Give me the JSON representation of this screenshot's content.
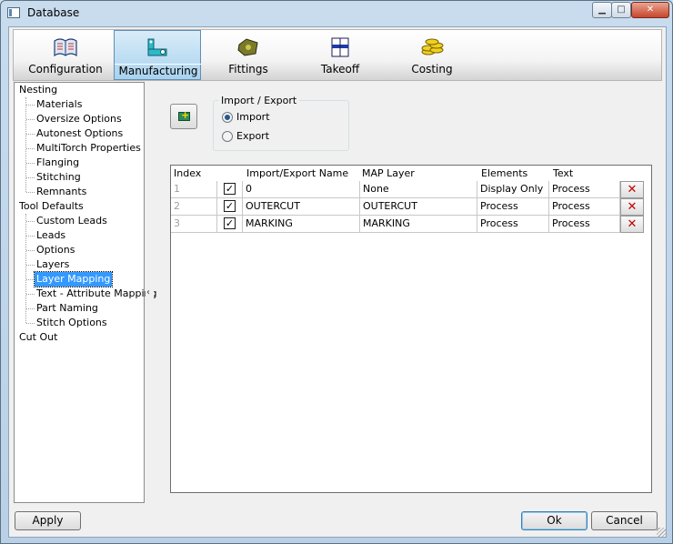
{
  "window": {
    "title": "Database"
  },
  "toolbar": {
    "items": [
      {
        "label": "Configuration",
        "icon": "book-icon",
        "active": false
      },
      {
        "label": "Manufacturing",
        "icon": "machine-icon",
        "active": true
      },
      {
        "label": "Fittings",
        "icon": "fitting-icon",
        "active": false
      },
      {
        "label": "Takeoff",
        "icon": "takeoff-icon",
        "active": false
      },
      {
        "label": "Costing",
        "icon": "coins-icon",
        "active": false
      }
    ]
  },
  "tree": {
    "items": [
      {
        "label": "Nesting",
        "level": 0
      },
      {
        "label": "Materials",
        "level": 1
      },
      {
        "label": "Oversize Options",
        "level": 1
      },
      {
        "label": "Autonest Options",
        "level": 1
      },
      {
        "label": "MultiTorch Properties",
        "level": 1
      },
      {
        "label": "Flanging",
        "level": 1
      },
      {
        "label": "Stitching",
        "level": 1
      },
      {
        "label": "Remnants",
        "level": 1
      },
      {
        "label": "Tool Defaults",
        "level": 0
      },
      {
        "label": "Custom Leads",
        "level": 1
      },
      {
        "label": "Leads",
        "level": 1
      },
      {
        "label": "Options",
        "level": 1
      },
      {
        "label": "Layers",
        "level": 1
      },
      {
        "label": "Layer Mapping",
        "level": 1,
        "selected": true
      },
      {
        "label": "Text - Attribute Mapping",
        "level": 1
      },
      {
        "label": "Part Naming",
        "level": 1
      },
      {
        "label": "Stitch Options",
        "level": 1
      },
      {
        "label": "Cut Out",
        "level": 0
      }
    ]
  },
  "import_export": {
    "title": "Import / Export",
    "options": [
      "Import",
      "Export"
    ],
    "selected": "Import"
  },
  "grid": {
    "columns": [
      "Index",
      "Import/Export Name",
      "MAP Layer",
      "Elements",
      "Text"
    ],
    "rows": [
      {
        "index": "1",
        "checked": true,
        "name": "0",
        "map_layer": "None",
        "elements": "Display Only",
        "text": "Process"
      },
      {
        "index": "2",
        "checked": true,
        "name": "OUTERCUT",
        "map_layer": "OUTERCUT",
        "elements": "Process",
        "text": "Process"
      },
      {
        "index": "3",
        "checked": true,
        "name": "MARKING",
        "map_layer": "MARKING",
        "elements": "Process",
        "text": "Process"
      }
    ]
  },
  "buttons": {
    "apply": "Apply",
    "ok": "Ok",
    "cancel": "Cancel"
  },
  "colors": {
    "selection": "#3399ff",
    "active_tab": "#a9d2ee",
    "delete_x": "#c00000"
  }
}
